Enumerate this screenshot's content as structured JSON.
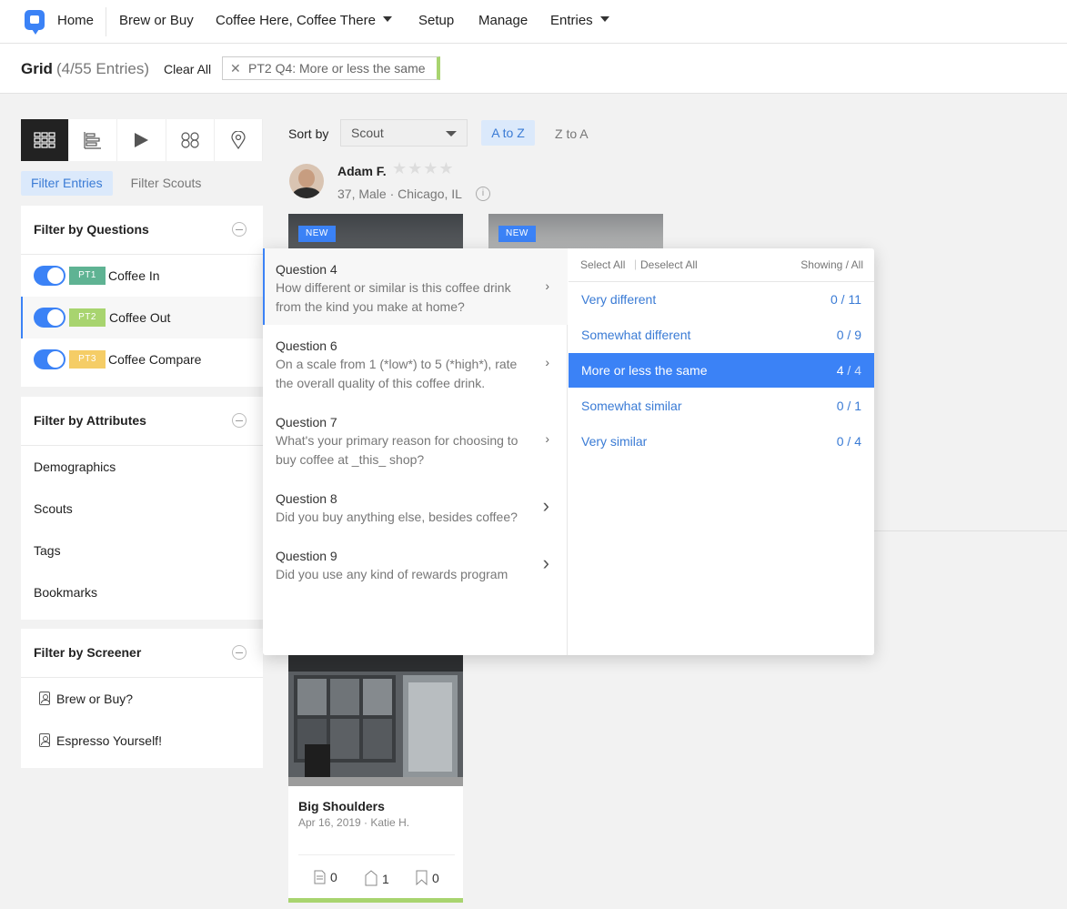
{
  "nav": {
    "items": [
      "Home",
      "Brew or Buy",
      "Coffee Here, Coffee There",
      "Setup",
      "Manage",
      "Entries"
    ]
  },
  "header": {
    "title": "Grid",
    "count": "(4/55 Entries)",
    "clear_all": "Clear All",
    "active_filter": "PT2 Q4: More or less the same"
  },
  "view_modes": [
    "grid-view-icon",
    "bar-chart-icon",
    "play-icon",
    "cluster-icon",
    "map-pin-icon"
  ],
  "filter_tabs": [
    "Filter Entries",
    "Filter Scouts"
  ],
  "filter_questions": {
    "title": "Filter by Questions",
    "parts": [
      {
        "tag": "PT1",
        "label": "Coffee In",
        "color": "#5fb393"
      },
      {
        "tag": "PT2",
        "label": "Coffee Out",
        "color": "#a8d46f"
      },
      {
        "tag": "PT3",
        "label": "Coffee Compare",
        "color": "#f5cd66"
      }
    ]
  },
  "filter_attributes": {
    "title": "Filter by Attributes",
    "items": [
      "Demographics",
      "Scouts",
      "Tags",
      "Bookmarks"
    ]
  },
  "filter_screener": {
    "title": "Filter by Screener",
    "items": [
      "Brew or Buy?",
      "Espresso Yourself!"
    ]
  },
  "sort": {
    "label": "Sort by",
    "value": "Scout",
    "az": "A to Z",
    "za": "Z to A"
  },
  "scout": {
    "name": "Adam F.",
    "meta": "37, Male · Chicago, IL",
    "rating": 0,
    "max_rating": 5
  },
  "badges": {
    "new": "NEW"
  },
  "questions": [
    {
      "num": "Question 4",
      "text": "How different or similar is this coffee drink from the kind you make at home?"
    },
    {
      "num": "Question 6",
      "text": "On a scale from 1 (*low*) to 5 (*high*), rate the overall quality of this coffee drink."
    },
    {
      "num": "Question 7",
      "text": "What's your primary reason for choosing to buy coffee at _this_ shop?"
    },
    {
      "num": "Question 8",
      "text": "Did you buy anything else, besides coffee?"
    },
    {
      "num": "Question 9",
      "text": "Did you use any kind of rewards program"
    }
  ],
  "answers": {
    "select_all": "Select All",
    "separator": "|",
    "deselect_all": "Deselect All",
    "showing": "Showing / All",
    "options": [
      {
        "label": "Very different",
        "shown": "0",
        "all": "11"
      },
      {
        "label": "Somewhat different",
        "shown": "0",
        "all": "9"
      },
      {
        "label": "More or less the same",
        "shown": "4",
        "all": "4"
      },
      {
        "label": "Somewhat similar",
        "shown": "0",
        "all": "1"
      },
      {
        "label": "Very similar",
        "shown": "0",
        "all": "4"
      }
    ]
  },
  "card": {
    "title": "Big Shoulders",
    "meta": "Apr 16, 2019 · Katie H.",
    "notes": "0",
    "tags": "1",
    "bookmarks": "0"
  }
}
